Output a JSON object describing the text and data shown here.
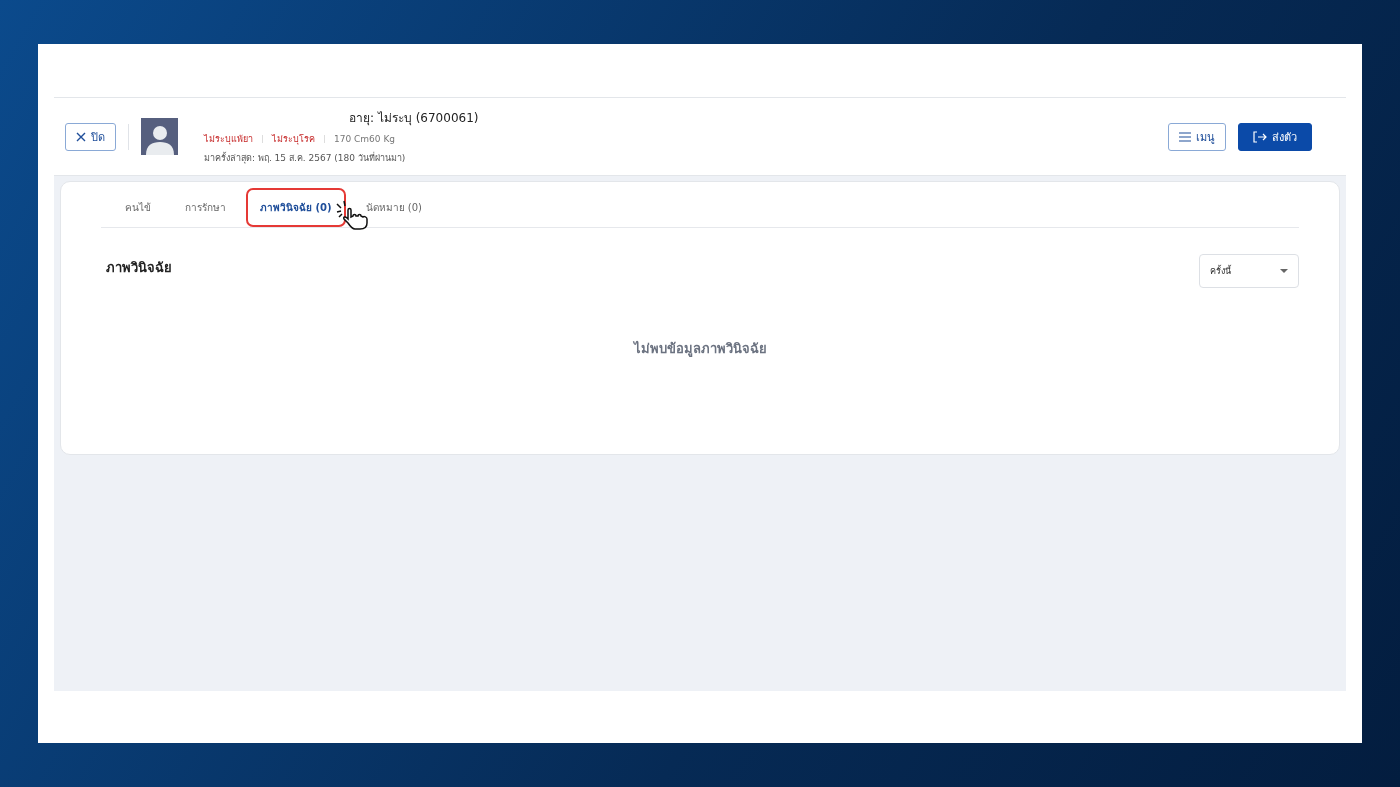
{
  "header": {
    "close_button": "ปิด",
    "age": "อายุ: ไม่ระบุ  (6700061)",
    "tags": [
      {
        "text": "ไม่ระบุแพ้ยา",
        "kind": "warning"
      },
      {
        "text": "ไม่ระบุโรค",
        "kind": "warning"
      },
      {
        "text": "170 Cm60 Kg",
        "kind": "info"
      }
    ],
    "last_visit": "มาครั้งล่าสุด: พฤ. 15 ส.ค. 2567 (180 วันที่ผ่านมา)",
    "menu_button": "เมนู",
    "send_button": "ส่งตัว"
  },
  "tabs": [
    {
      "label": "คนไข้",
      "selected": false
    },
    {
      "label": "การรักษา",
      "selected": false
    },
    {
      "label": "ภาพวินิจฉัย (0)",
      "selected": true
    },
    {
      "label": "นัดหมาย (0)",
      "selected": false
    }
  ],
  "section": {
    "title": "ภาพวินิจฉัย",
    "filter": "ครั้งนี้",
    "empty_message": "ไม่พบข้อมูลภาพวินิจฉัย"
  }
}
